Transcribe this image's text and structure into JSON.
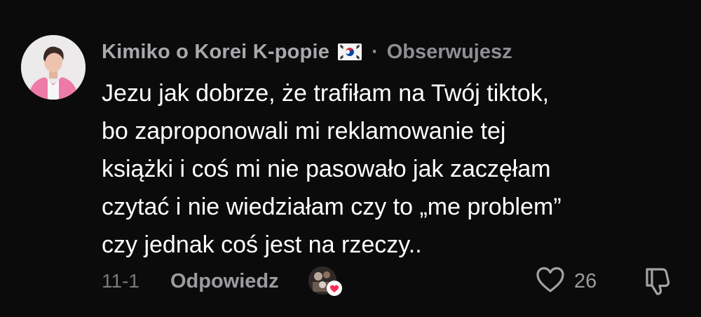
{
  "comment": {
    "username": "Kimiko o Korei K-popie",
    "flag_icon": "south-korea-flag-icon",
    "separator": "·",
    "follow_status": "Obserwujesz",
    "text_lines": [
      "Jezu jak dobrze, że trafiłam na Twój tiktok,",
      "bo zaproponowali mi reklamowanie tej",
      "książki i coś mi nie pasowało jak zaczęłam",
      "czytać i nie wiedziałam czy to „me problem”",
      "czy jednak coś jest na rzeczy.."
    ],
    "timestamp": "11-1",
    "reply_label": "Odpowiedz",
    "like_count": "26",
    "icons": {
      "like": "heart-outline-icon",
      "dislike": "thumbs-down-icon",
      "creator_liked": "heart-badge-icon"
    },
    "colors": {
      "background": "#0b0b0b",
      "text": "#ffffff",
      "muted": "#8e8e93",
      "heart_badge": "#fe2c55"
    }
  }
}
